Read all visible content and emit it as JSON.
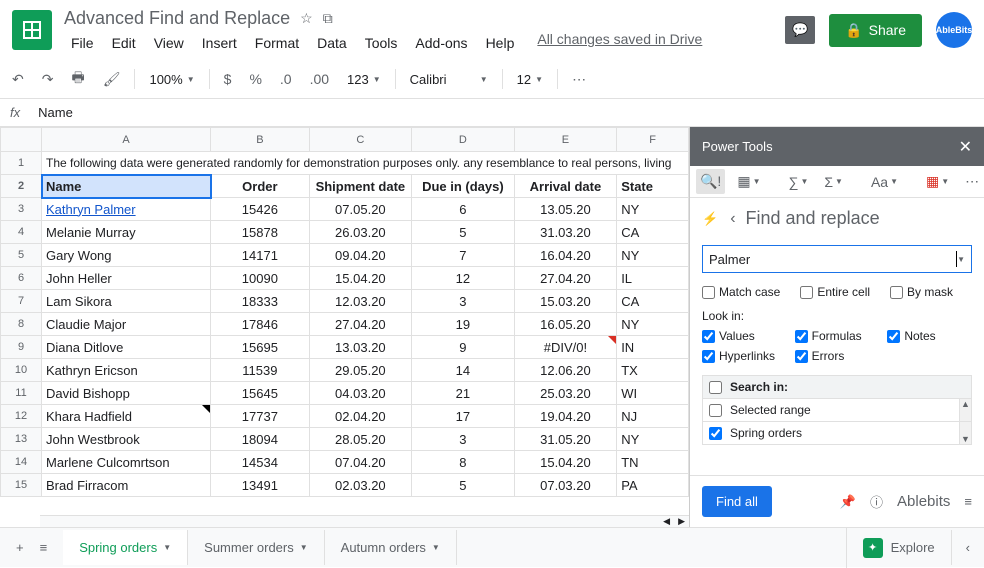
{
  "header": {
    "doc_title": "Advanced Find and Replace",
    "menus": [
      "File",
      "Edit",
      "View",
      "Insert",
      "Format",
      "Data",
      "Tools",
      "Add-ons",
      "Help"
    ],
    "changes_saved": "All changes saved in Drive",
    "share_label": "Share",
    "avatar_label": "AbleBits"
  },
  "toolbar": {
    "zoom": "100%",
    "123": "123",
    "font": "Calibri",
    "font_size": "12"
  },
  "formula_bar": {
    "fx": "fx",
    "value": "Name"
  },
  "grid": {
    "col_letters": [
      "A",
      "B",
      "C",
      "D",
      "E",
      "F"
    ],
    "note_row": "The following data were generated randomly for demonstration purposes only. any resemblance to real persons, living",
    "headers": [
      "Name",
      "Order",
      "Shipment date",
      "Due in (days)",
      "Arrival date",
      "State"
    ],
    "rows": [
      {
        "n": "3",
        "name": "Kathryn Palmer",
        "link": true,
        "order": "15426",
        "ship": "07.05.20",
        "due": "6",
        "arr": "13.05.20",
        "state": "NY"
      },
      {
        "n": "4",
        "name": "Melanie Murray",
        "order": "15878",
        "ship": "26.03.20",
        "due": "5",
        "arr": "31.03.20",
        "state": "CA"
      },
      {
        "n": "5",
        "name": "Gary Wong",
        "order": "14171",
        "ship": "09.04.20",
        "due": "7",
        "arr": "16.04.20",
        "state": "NY"
      },
      {
        "n": "6",
        "name": "John Heller",
        "order": "10090",
        "ship": "15.04.20",
        "due": "12",
        "arr": "27.04.20",
        "state": "IL"
      },
      {
        "n": "7",
        "name": "Lam Sikora",
        "order": "18333",
        "ship": "12.03.20",
        "due": "3",
        "arr": "15.03.20",
        "state": "CA"
      },
      {
        "n": "8",
        "name": "Claudie Major",
        "order": "17846",
        "ship": "27.04.20",
        "due": "19",
        "arr": "16.05.20",
        "state": "NY"
      },
      {
        "n": "9",
        "name": "Diana Ditlove",
        "order": "15695",
        "ship": "13.03.20",
        "due": "9",
        "arr": "#DIV/0!",
        "state": "IN",
        "err": true
      },
      {
        "n": "10",
        "name": "Kathryn Ericson",
        "order": "11539",
        "ship": "29.05.20",
        "due": "14",
        "arr": "12.06.20",
        "state": "TX"
      },
      {
        "n": "11",
        "name": "David Bishopp",
        "order": "15645",
        "ship": "04.03.20",
        "due": "21",
        "arr": "25.03.20",
        "state": "WI"
      },
      {
        "n": "12",
        "name": "Khara Hadfield",
        "order": "17737",
        "ship": "02.04.20",
        "due": "17",
        "arr": "19.04.20",
        "state": "NJ",
        "note": true
      },
      {
        "n": "13",
        "name": "John Westbrook",
        "order": "18094",
        "ship": "28.05.20",
        "due": "3",
        "arr": "31.05.20",
        "state": "NY"
      },
      {
        "n": "14",
        "name": "Marlene Culcomrtson",
        "order": "14534",
        "ship": "07.04.20",
        "due": "8",
        "arr": "15.04.20",
        "state": "TN"
      },
      {
        "n": "15",
        "name": "Brad Firracom",
        "order": "13491",
        "ship": "02.03.20",
        "due": "5",
        "arr": "07.03.20",
        "state": "PA"
      }
    ]
  },
  "sidebar": {
    "title": "Power Tools",
    "find_title": "Find and replace",
    "search_value": "Palmer",
    "match_case": "Match case",
    "entire_cell": "Entire cell",
    "by_mask": "By mask",
    "look_in_label": "Look in:",
    "look_in": [
      "Values",
      "Formulas",
      "Notes",
      "Hyperlinks",
      "Errors"
    ],
    "search_in_label": "Search in:",
    "search_items": [
      {
        "label": "Selected range",
        "checked": false
      },
      {
        "label": "Spring orders",
        "checked": true
      }
    ],
    "find_btn": "Find all",
    "brand": "Ablebits"
  },
  "tabs": {
    "items": [
      "Spring orders",
      "Summer orders",
      "Autumn orders"
    ],
    "active_index": 0,
    "explore": "Explore"
  }
}
